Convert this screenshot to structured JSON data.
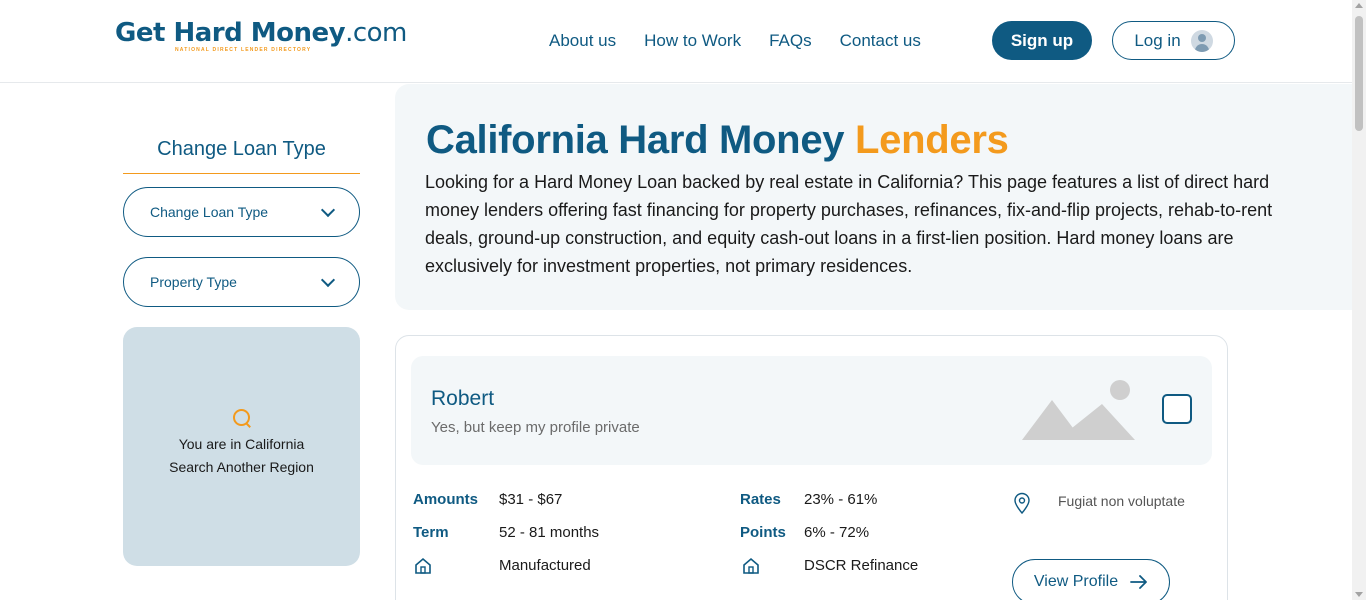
{
  "header": {
    "logo_main": "Get Hard Money",
    "logo_suffix": ".com",
    "logo_tagline": "NATIONAL DIRECT LENDER DIRECTORY",
    "nav": [
      "About us",
      "How to Work",
      "FAQs",
      "Contact us"
    ],
    "signup_label": "Sign up",
    "login_label": "Log in"
  },
  "sidebar": {
    "title": "Change Loan Type",
    "loan_type_select": "Change Loan Type",
    "property_type_select": "Property Type",
    "region_line1": "You are in California",
    "region_line2": "Search Another Region"
  },
  "hero": {
    "title_main": "California Hard Money",
    "title_accent": "Lenders",
    "description": "Looking for a Hard Money Loan backed by real estate in California? This page features a list of direct hard money lenders offering fast financing for property purchases, refinances, fix-and-flip projects, rehab-to-rent deals, ground-up construction, and equity cash-out loans in a first-lien position. Hard money loans are exclusively for investment properties, not primary residences."
  },
  "lender": {
    "name": "Robert",
    "subtitle": "Yes, but keep my profile private",
    "amounts_label": "Amounts",
    "amounts_value": "$31 - $67",
    "term_label": "Term",
    "term_value": "52 - 81 months",
    "property_value": "Manufactured",
    "rates_label": "Rates",
    "rates_value": "23% - 61%",
    "points_label": "Points",
    "points_value": "6% - 72%",
    "loan_value": "DSCR Refinance",
    "location": "Fugiat non voluptate",
    "view_profile_label": "View Profile"
  },
  "colors": {
    "brand": "#0f5a82",
    "accent": "#f39a1d"
  }
}
